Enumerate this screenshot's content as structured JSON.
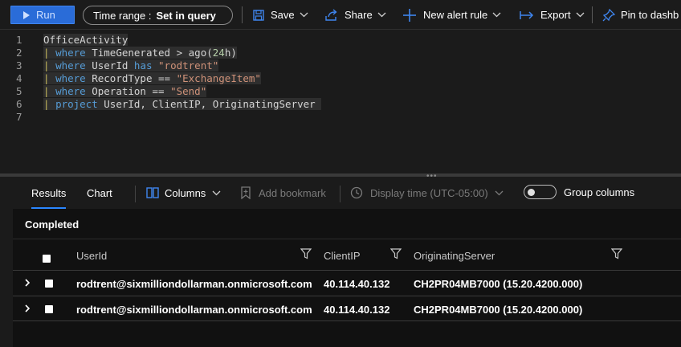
{
  "toolbar": {
    "run_label": "Run",
    "time_range_label": "Time range :",
    "time_range_value": "Set in query",
    "save_label": "Save",
    "share_label": "Share",
    "new_alert_label": "New alert rule",
    "export_label": "Export",
    "pin_label": "Pin to dashb"
  },
  "editor": {
    "line_numbers": [
      "1",
      "2",
      "3",
      "4",
      "5",
      "6",
      "7"
    ]
  },
  "results": {
    "tab_results": "Results",
    "tab_chart": "Chart",
    "columns_label": "Columns",
    "bookmark_label": "Add bookmark",
    "display_time_label": "Display time (UTC-05:00)",
    "group_columns_label": "Group columns",
    "status": "Completed",
    "columns": [
      "UserId",
      "ClientIP",
      "OriginatingServer"
    ],
    "rows": [
      {
        "UserId": "rodtrent@sixmilliondollarman.onmicrosoft.com",
        "ClientIP": "40.114.40.132",
        "OriginatingServer": "CH2PR04MB7000 (15.20.4200.000)"
      },
      {
        "UserId": "rodtrent@sixmilliondollarman.onmicrosoft.com",
        "ClientIP": "40.114.40.132",
        "OriginatingServer": "CH2PR04MB7000 (15.20.4200.000)"
      }
    ]
  },
  "colors": {
    "accent": "#2a6cd8",
    "tab_underline": "#2a86ff",
    "keyword": "#569cd6",
    "string": "#ce9178",
    "number": "#b5cea8",
    "pipe": "#c6b85b"
  },
  "icons": [
    "play-icon",
    "save-icon",
    "share-icon",
    "plus-icon",
    "export-icon",
    "pin-icon",
    "columns-icon",
    "bookmark-icon",
    "clock-icon",
    "filter-icon",
    "chevron-right-icon",
    "chevron-down-icon"
  ]
}
